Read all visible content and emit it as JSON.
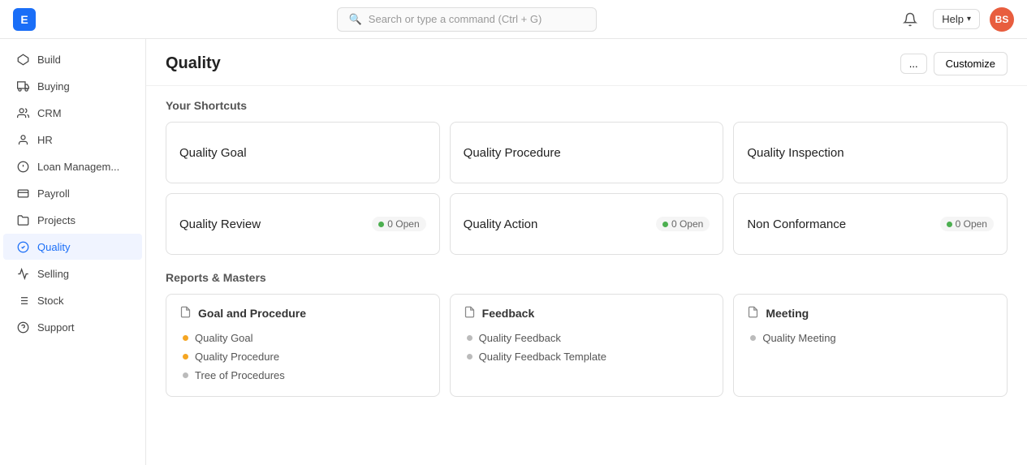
{
  "topbar": {
    "app_letter": "E",
    "search_placeholder": "Search or type a command (Ctrl + G)",
    "help_label": "Help",
    "avatar_initials": "BS"
  },
  "sidebar": {
    "items": [
      {
        "label": "Build",
        "icon": "build-icon",
        "active": false
      },
      {
        "label": "Buying",
        "icon": "buying-icon",
        "active": false
      },
      {
        "label": "CRM",
        "icon": "crm-icon",
        "active": false
      },
      {
        "label": "HR",
        "icon": "hr-icon",
        "active": false
      },
      {
        "label": "Loan Managem...",
        "icon": "loan-icon",
        "active": false
      },
      {
        "label": "Payroll",
        "icon": "payroll-icon",
        "active": false
      },
      {
        "label": "Projects",
        "icon": "projects-icon",
        "active": false
      },
      {
        "label": "Quality",
        "icon": "quality-icon",
        "active": true
      },
      {
        "label": "Selling",
        "icon": "selling-icon",
        "active": false
      },
      {
        "label": "Stock",
        "icon": "stock-icon",
        "active": false
      },
      {
        "label": "Support",
        "icon": "support-icon",
        "active": false
      }
    ]
  },
  "page": {
    "title": "Quality",
    "more_label": "...",
    "customize_label": "Customize"
  },
  "shortcuts": {
    "section_title": "Your Shortcuts",
    "cards": [
      {
        "title": "Quality Goal",
        "badge": null
      },
      {
        "title": "Quality Procedure",
        "badge": null
      },
      {
        "title": "Quality Inspection",
        "badge": null
      },
      {
        "title": "Quality Review",
        "badge": "0 Open"
      },
      {
        "title": "Quality Action",
        "badge": "0 Open"
      },
      {
        "title": "Non Conformance",
        "badge": "0 Open"
      }
    ]
  },
  "reports": {
    "section_title": "Reports & Masters",
    "groups": [
      {
        "title": "Goal and Procedure",
        "items": [
          {
            "label": "Quality Goal",
            "bullet": "orange"
          },
          {
            "label": "Quality Procedure",
            "bullet": "orange"
          },
          {
            "label": "Tree of Procedures",
            "bullet": "gray"
          }
        ]
      },
      {
        "title": "Feedback",
        "items": [
          {
            "label": "Quality Feedback",
            "bullet": "gray"
          },
          {
            "label": "Quality Feedback Template",
            "bullet": "gray"
          }
        ]
      },
      {
        "title": "Meeting",
        "items": [
          {
            "label": "Quality Meeting",
            "bullet": "gray"
          }
        ]
      }
    ]
  }
}
